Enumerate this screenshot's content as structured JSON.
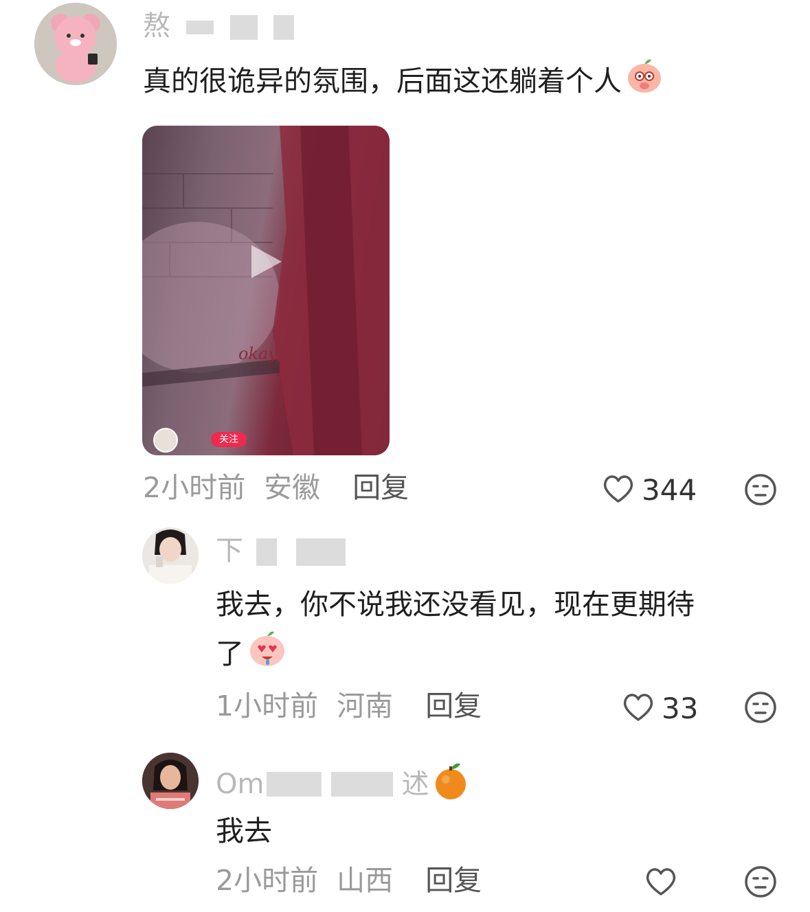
{
  "comments": [
    {
      "username": "熬",
      "text": "真的很诡异的氛围，后面这还躺着个人",
      "video": {
        "follow_label": "关注",
        "watermark": "okayfi"
      },
      "time": "2小时前",
      "location": "安徽",
      "reply_label": "回复",
      "likes": "344"
    },
    {
      "username": "下",
      "text_line1": "我去，你不说我还没看见，现在更期待",
      "text_line2": "了",
      "time": "1小时前",
      "location": "河南",
      "reply_label": "回复",
      "likes": "33"
    },
    {
      "username": "Om",
      "username_tail": "述",
      "text": "我去",
      "time": "2小时前",
      "location": "山西",
      "reply_label": "回复",
      "likes": ""
    }
  ],
  "icons": {
    "like": "heart-outline-icon",
    "dislike": "neutral-face-icon",
    "play": "play-icon"
  }
}
